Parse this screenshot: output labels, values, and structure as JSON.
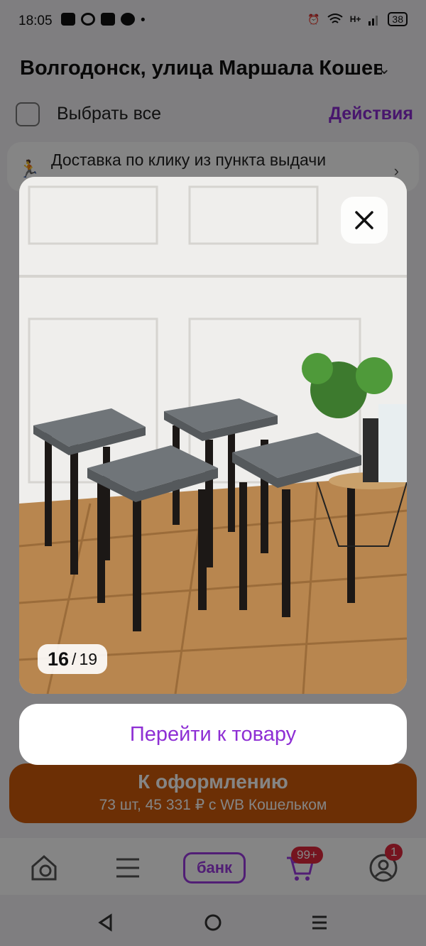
{
  "status": {
    "time": "18:05",
    "battery": "38",
    "network": "H+"
  },
  "page": {
    "address": "Волгодонск, улица Маршала Кошевого",
    "select_all": "Выбрать все",
    "actions": "Действия",
    "delivery": "Доставка по клику из пункта выдачи",
    "checkout_title": "К оформлению",
    "checkout_sub": "73 шт, 45 331 ₽ с WB Кошельком"
  },
  "tabbar": {
    "bank": "банк",
    "cart_badge": "99+",
    "profile_badge": "1"
  },
  "viewer": {
    "current": "16",
    "separator": "/",
    "total": "19",
    "goto": "Перейти к товару"
  },
  "colors": {
    "accent": "#8e2fd4",
    "checkout": "#cf5a0a",
    "badge": "#e0283c"
  }
}
